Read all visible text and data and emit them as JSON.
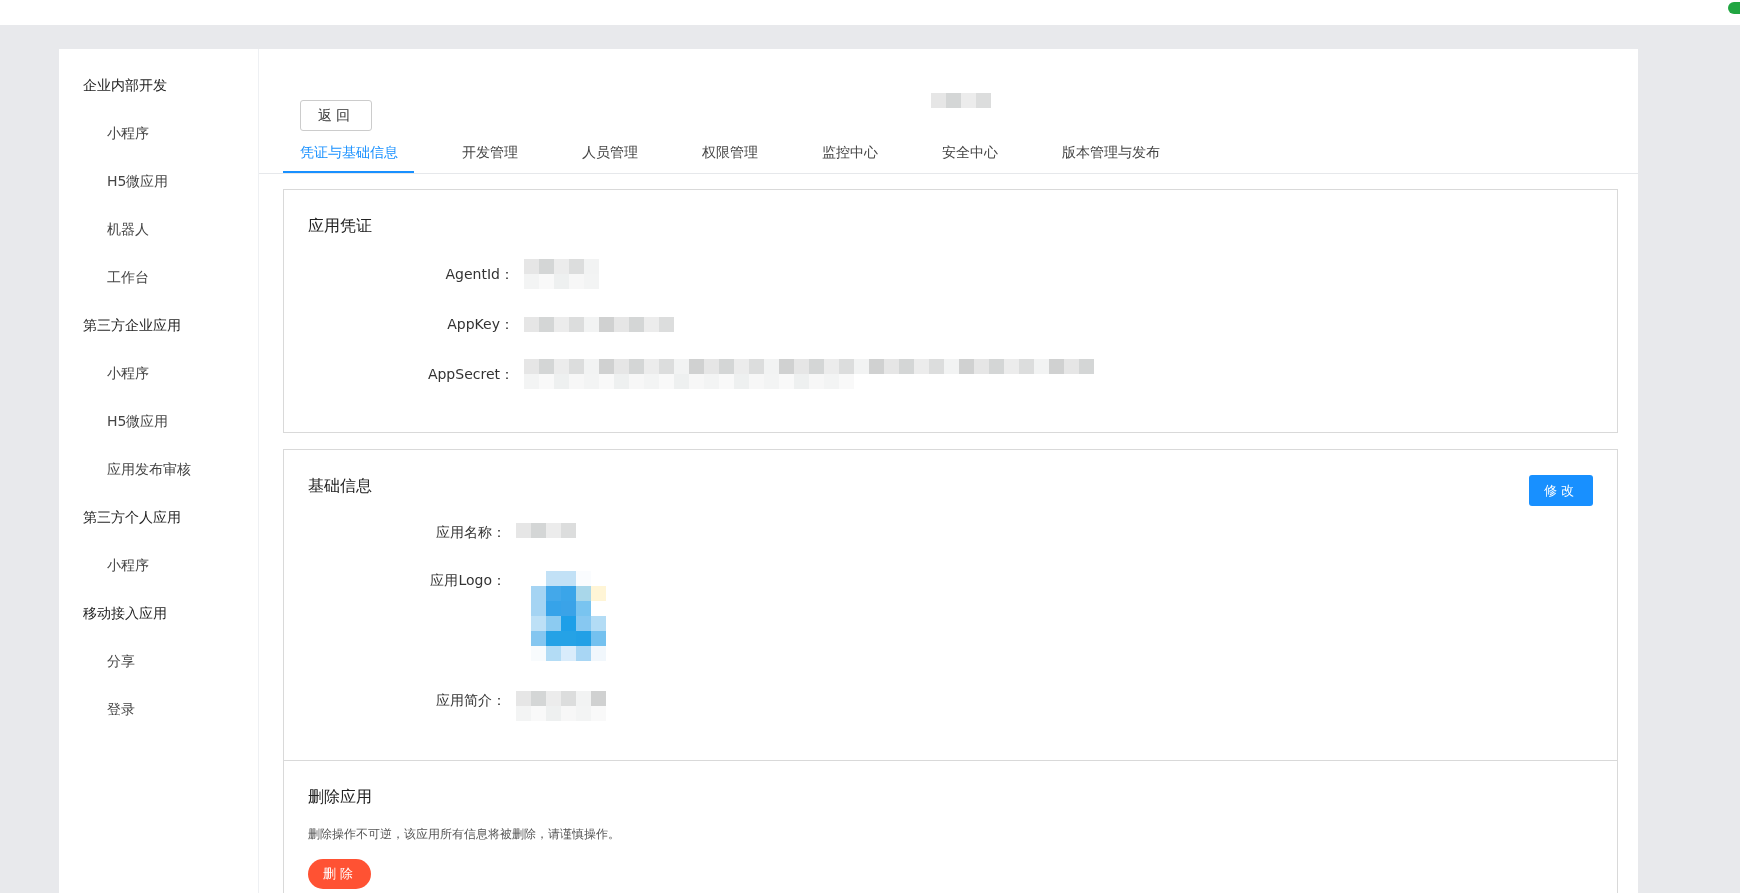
{
  "sidebar": {
    "groups": [
      {
        "title": "企业内部开发",
        "items": [
          {
            "label": "小程序"
          },
          {
            "label": "H5微应用"
          },
          {
            "label": "机器人"
          },
          {
            "label": "工作台"
          }
        ]
      },
      {
        "title": "第三方企业应用",
        "items": [
          {
            "label": "小程序"
          },
          {
            "label": "H5微应用"
          },
          {
            "label": "应用发布审核"
          }
        ]
      },
      {
        "title": "第三方个人应用",
        "items": [
          {
            "label": "小程序"
          }
        ]
      },
      {
        "title": "移动接入应用",
        "items": [
          {
            "label": "分享"
          },
          {
            "label": "登录"
          }
        ]
      }
    ]
  },
  "back_button": "返回",
  "tabs": [
    {
      "label": "凭证与基础信息",
      "selected": true
    },
    {
      "label": "开发管理",
      "selected": false
    },
    {
      "label": "人员管理",
      "selected": false
    },
    {
      "label": "权限管理",
      "selected": false
    },
    {
      "label": "监控中心",
      "selected": false
    },
    {
      "label": "安全中心",
      "selected": false
    },
    {
      "label": "版本管理与发布",
      "selected": false
    }
  ],
  "credentials": {
    "title": "应用凭证",
    "fields": [
      {
        "label": "AgentId："
      },
      {
        "label": "AppKey："
      },
      {
        "label": "AppSecret："
      }
    ]
  },
  "basic_info": {
    "title": "基础信息",
    "edit_button": "修改",
    "fields": [
      {
        "label": "应用名称：",
        "kind": "text"
      },
      {
        "label": "应用Logo：",
        "kind": "logo"
      },
      {
        "label": "应用简介：",
        "kind": "text"
      }
    ]
  },
  "delete_app": {
    "title": "删除应用",
    "description": "删除操作不可逆，该应用所有信息将被删除，请谨慎操作。",
    "button": "删除"
  }
}
